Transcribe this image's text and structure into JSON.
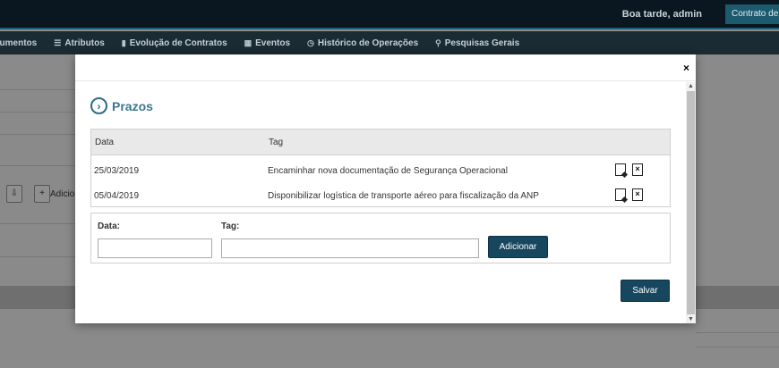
{
  "topbar": {
    "greeting": "Boa tarde, admin",
    "contract_button": "Contrato de E"
  },
  "nav": {
    "items": [
      {
        "label": "cumentos",
        "icon": ""
      },
      {
        "label": "Atributos",
        "icon": "list-icon"
      },
      {
        "label": "Evolução de Contratos",
        "icon": "bar-chart-icon"
      },
      {
        "label": "Eventos",
        "icon": "calendar-icon"
      },
      {
        "label": "Histórico de Operações",
        "icon": "history-icon"
      },
      {
        "label": "Pesquisas Gerais",
        "icon": "search-icon"
      }
    ]
  },
  "background": {
    "add_label": "Adicior"
  },
  "modal": {
    "close_label": "×",
    "section_title": "Prazos",
    "table": {
      "columns": [
        "Data",
        "Tag"
      ],
      "rows": [
        {
          "date": "25/03/2019",
          "tag": "Encaminhar nova documentação de Segurança Operacional"
        },
        {
          "date": "05/04/2019",
          "tag": "Disponibilizar logística de transporte aéreo para fiscalização da ANP"
        }
      ]
    },
    "form": {
      "date_label": "Data:",
      "tag_label": "Tag:",
      "date_value": "",
      "tag_value": "",
      "add_button": "Adicionar"
    },
    "save_button": "Salvar"
  },
  "colors": {
    "primary_button": "#17465f",
    "title_accent": "#3a7791",
    "topbar": "#0a1620",
    "navbar": "#1a2b34"
  }
}
